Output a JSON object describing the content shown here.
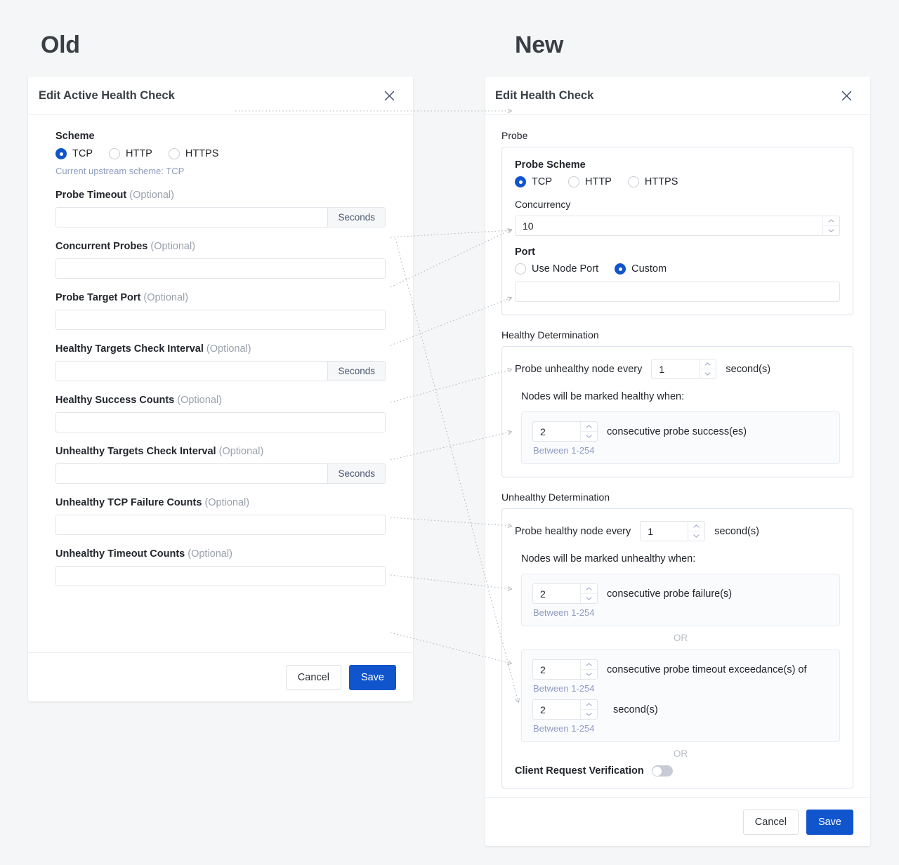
{
  "columns": {
    "old": "Old",
    "new": "New"
  },
  "old_panel": {
    "title": "Edit Active Health Check",
    "close_icon": "close-icon",
    "scheme": {
      "label": "Scheme",
      "options": [
        "TCP",
        "HTTP",
        "HTTPS"
      ],
      "selected": "TCP",
      "helper": "Current upstream scheme: TCP"
    },
    "fields": [
      {
        "label": "Probe Timeout",
        "optional": "(Optional)",
        "value": "",
        "suffix": "Seconds"
      },
      {
        "label": "Concurrent Probes",
        "optional": "(Optional)",
        "value": "",
        "suffix": ""
      },
      {
        "label": "Probe Target Port",
        "optional": "(Optional)",
        "value": "",
        "suffix": ""
      },
      {
        "label": "Healthy Targets Check Interval",
        "optional": "(Optional)",
        "value": "",
        "suffix": "Seconds"
      },
      {
        "label": "Healthy Success Counts",
        "optional": "(Optional)",
        "value": "",
        "suffix": ""
      },
      {
        "label": "Unhealthy Targets Check Interval",
        "optional": "(Optional)",
        "value": "",
        "suffix": "Seconds"
      },
      {
        "label": "Unhealthy TCP Failure Counts",
        "optional": "(Optional)",
        "value": "",
        "suffix": ""
      },
      {
        "label": "Unhealthy Timeout Counts",
        "optional": "(Optional)",
        "value": "",
        "suffix": ""
      }
    ],
    "footer": {
      "cancel": "Cancel",
      "save": "Save"
    }
  },
  "new_panel": {
    "title": "Edit Health Check",
    "close_icon": "close-icon",
    "probe": {
      "section_label": "Probe",
      "scheme_label": "Probe Scheme",
      "scheme_options": [
        "TCP",
        "HTTP",
        "HTTPS"
      ],
      "scheme_selected": "TCP",
      "concurrency_label": "Concurrency",
      "concurrency_value": "10",
      "port_label": "Port",
      "port_options": [
        "Use Node Port",
        "Custom"
      ],
      "port_selected": "Custom",
      "port_value": ""
    },
    "healthy": {
      "section_label": "Healthy Determination",
      "interval_prefix": "Probe unhealthy node every",
      "interval_value": "1",
      "interval_unit": "second(s)",
      "marked_text": "Nodes will be marked healthy when:",
      "rule_value": "2",
      "rule_text": "consecutive probe success(es)",
      "rule_hint": "Between 1-254"
    },
    "unhealthy": {
      "section_label": "Unhealthy Determination",
      "interval_prefix": "Probe healthy node every",
      "interval_value": "1",
      "interval_unit": "second(s)",
      "marked_text": "Nodes will be marked unhealthy when:",
      "rule1_value": "2",
      "rule1_text": "consecutive probe failure(s)",
      "rule1_hint": "Between 1-254",
      "or1": "OR",
      "rule2_value": "2",
      "rule2_text": "consecutive probe timeout exceedance(s) of",
      "rule2_hint": "Between 1-254",
      "rule2b_value": "2",
      "rule2b_text": "second(s)",
      "rule2b_hint": "Between 1-254",
      "or2": "OR",
      "verification_label": "Client Request Verification",
      "verification_on": false
    },
    "footer": {
      "cancel": "Cancel",
      "save": "Save"
    }
  },
  "colors": {
    "accent": "#1155cc",
    "page_bg": "#f5f6f7",
    "panel_bg": "#ffffff",
    "card_border": "#dbe4f0",
    "hint_blue": "#8e9cc0",
    "muted": "#9aa1ab",
    "connector": "#b4b8bd"
  }
}
